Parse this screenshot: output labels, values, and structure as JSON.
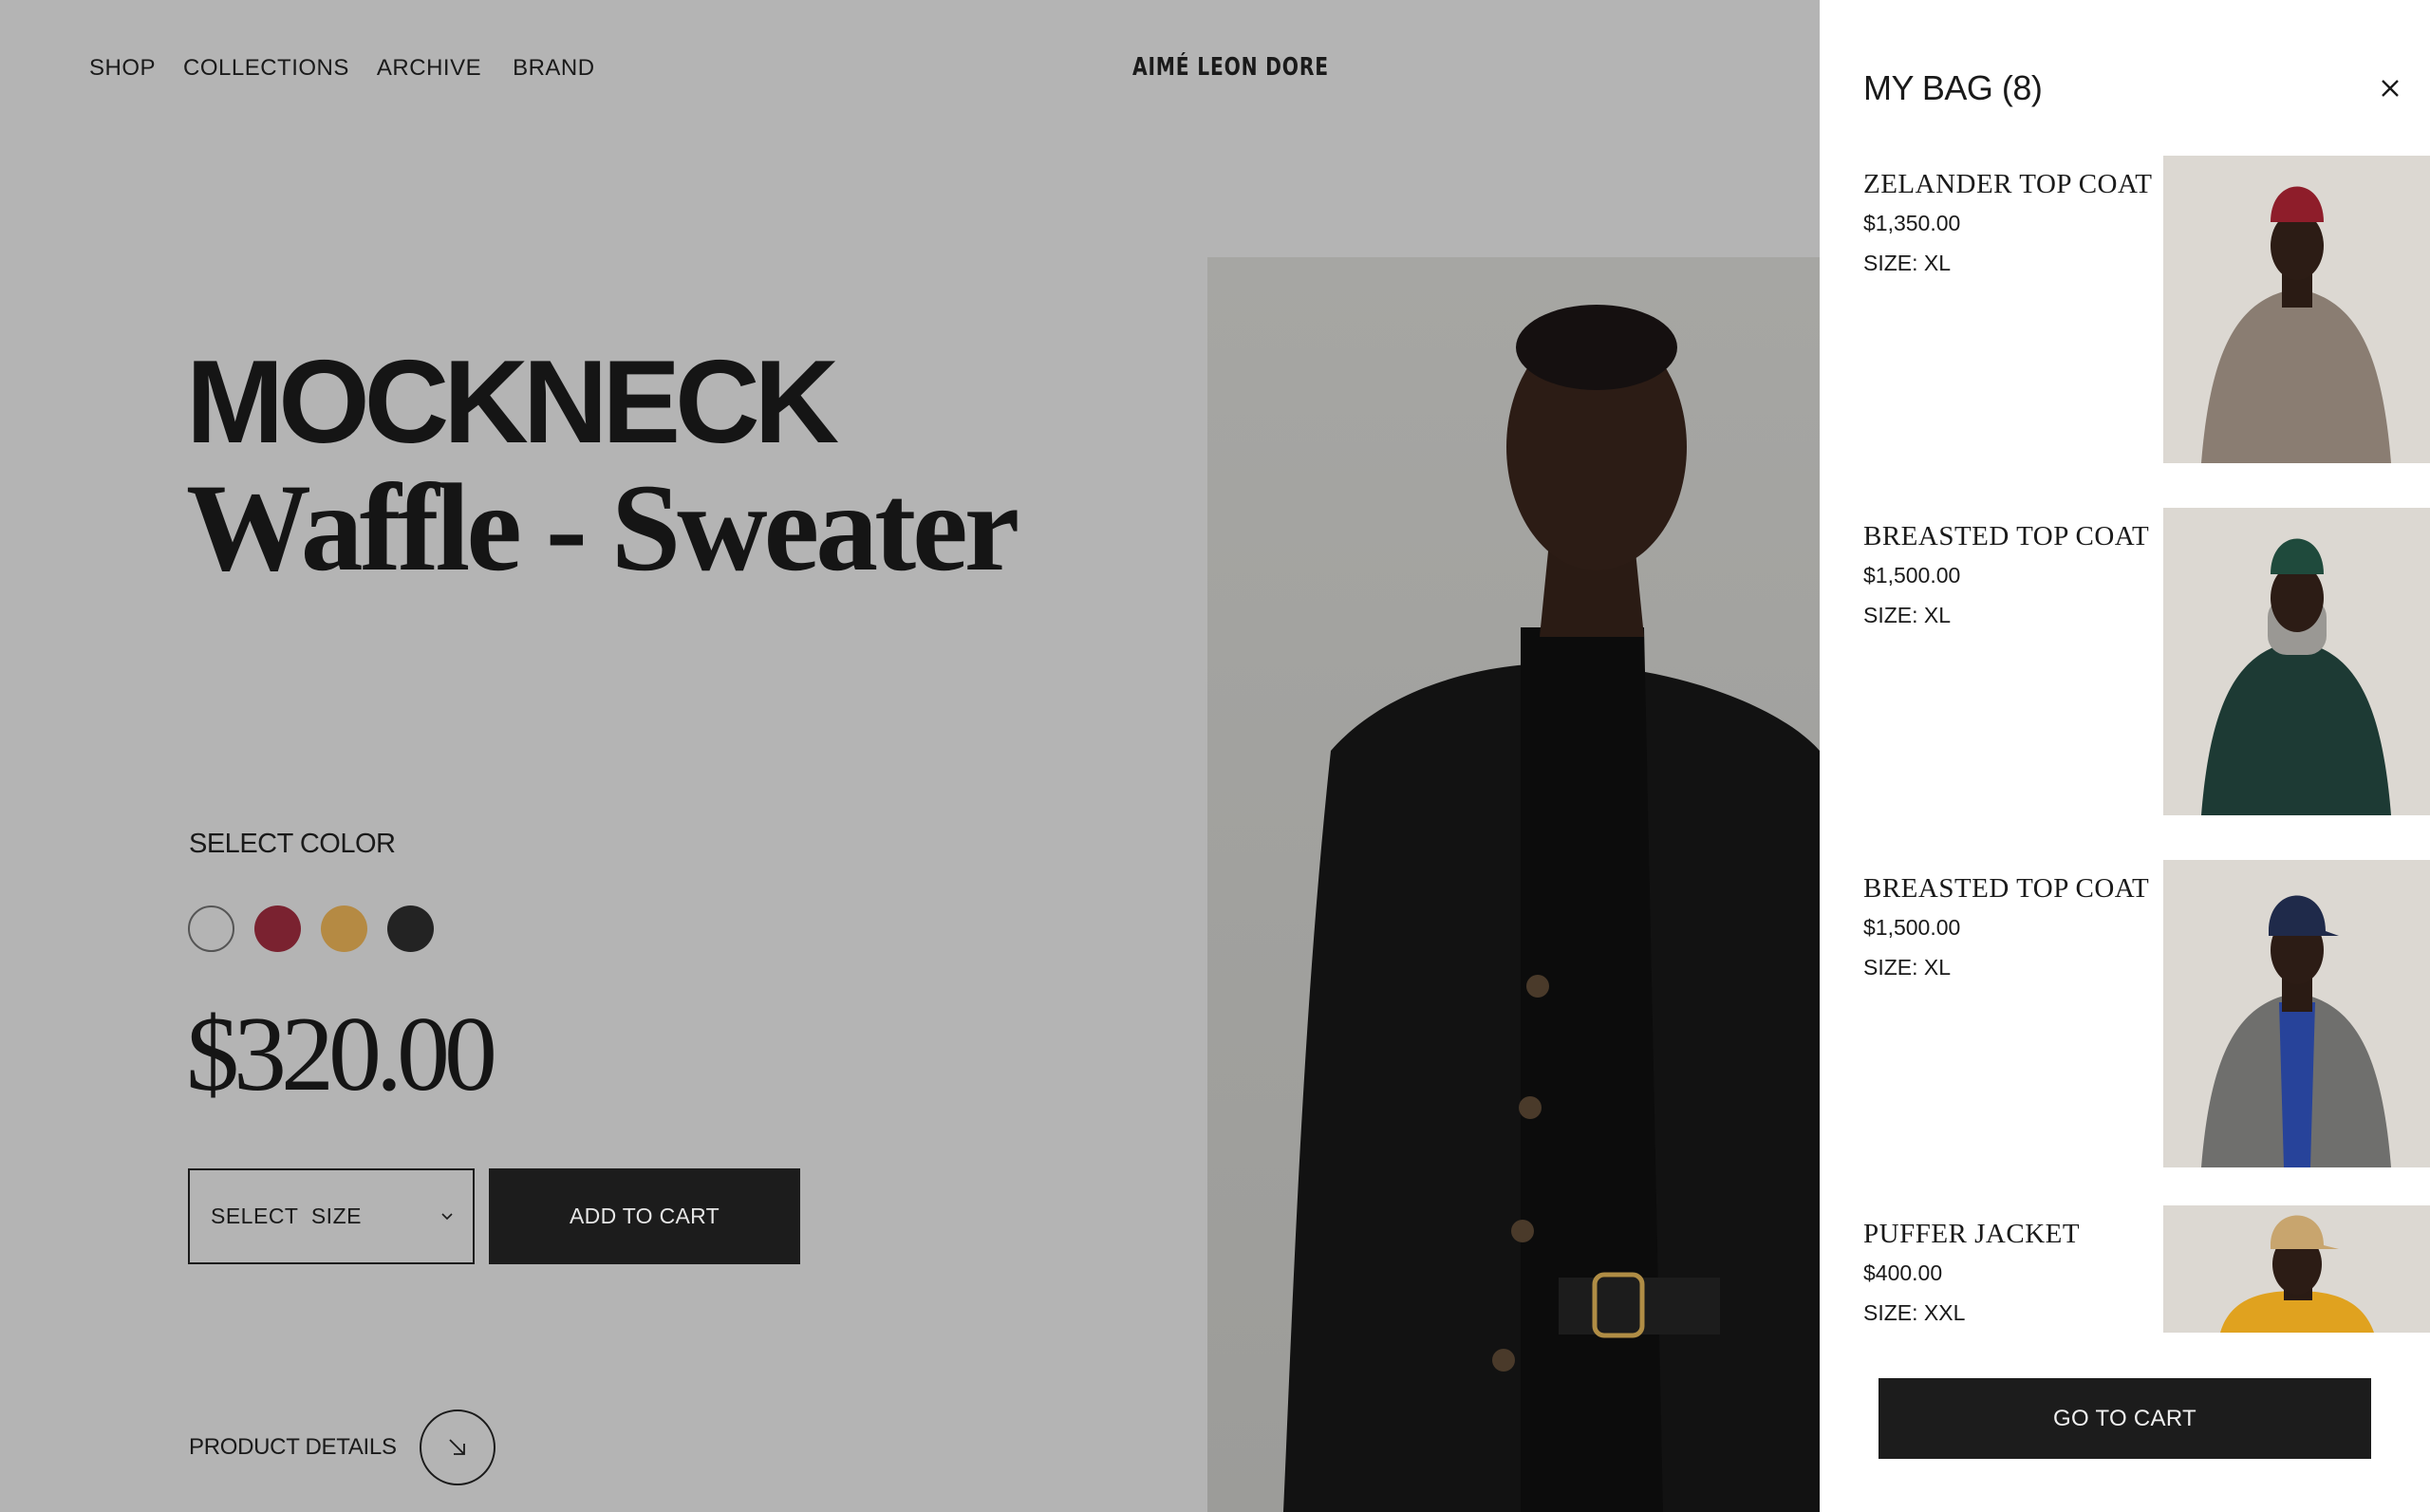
{
  "nav": {
    "items": [
      "SHOP",
      "COLLECTIONS",
      "ARCHIVE",
      "BRAND"
    ],
    "logo": "AIMÉ LEON DORE"
  },
  "product": {
    "title_line1": "MOCKNECK",
    "title_line2": "Waffle - Sweater",
    "select_color_label": "SELECT COLOR",
    "swatches": [
      {
        "name": "white",
        "color": "#b4b4b4"
      },
      {
        "name": "burgundy",
        "color": "#7a2230"
      },
      {
        "name": "camel",
        "color": "#b58a43"
      },
      {
        "name": "black",
        "color": "#232323"
      }
    ],
    "price": "$320.00",
    "size_select_label": "SELECT  SIZE",
    "add_to_cart_label": "ADD TO CART",
    "product_details_label": "PRODUCT DETAILS"
  },
  "bag": {
    "title": "MY BAG (8)",
    "items": [
      {
        "name": "ZELANDER TOP COAT",
        "price": "$1,350.00",
        "size": "SIZE: XL",
        "hat_color": "#8e1d2a",
        "coat_color": "#8a7d72"
      },
      {
        "name": "BREASTED TOP COAT",
        "price": "$1,500.00",
        "size": "SIZE: XL",
        "hat_color": "#1f4a3c",
        "coat_color": "#1d3a34"
      },
      {
        "name": "BREASTED TOP COAT",
        "price": "$1,500.00",
        "size": "SIZE: XL",
        "hat_color": "#1f2a4a",
        "coat_color": "#6f6f6d"
      },
      {
        "name": "PUFFER JACKET",
        "price": "$400.00",
        "size": "SIZE: XXL",
        "hat_color": "#c8a56e",
        "coat_color": "#e0a21f"
      }
    ],
    "go_to_cart_label": "GO TO CART"
  }
}
